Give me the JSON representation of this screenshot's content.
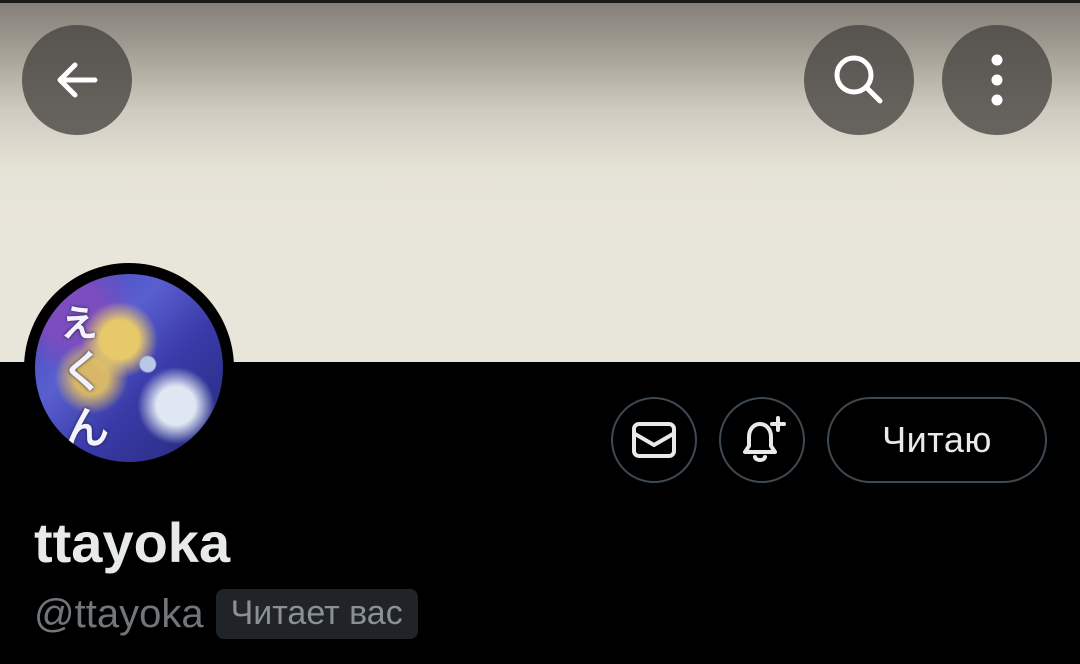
{
  "header": {
    "back_icon": "arrow-left-icon",
    "search_icon": "search-icon",
    "more_icon": "more-vertical-icon"
  },
  "profile": {
    "display_name": "ttayoka",
    "handle": "@ttayoka",
    "follows_you_badge": "Читает вас",
    "avatar_glyphs": [
      "ぇ",
      "く",
      "ん"
    ]
  },
  "actions": {
    "message_icon": "mail-icon",
    "notify_icon": "bell-plus-icon",
    "follow_label": "Читаю"
  },
  "colors": {
    "border": "#3e4952",
    "text_primary": "#e7e9ea",
    "text_secondary": "#71767b"
  }
}
